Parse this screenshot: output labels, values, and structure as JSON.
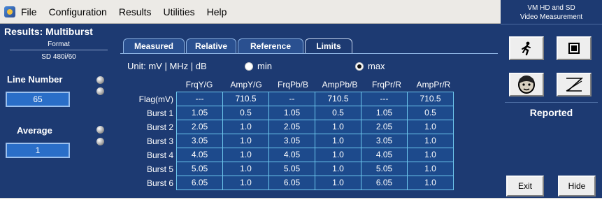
{
  "menubar": {
    "items": [
      "File",
      "Configuration",
      "Results",
      "Utilities",
      "Help"
    ]
  },
  "left_panel": {
    "title": "Results: Multiburst",
    "format_label": "Format",
    "format_value": "SD 480i/60",
    "line_number_label": "Line Number",
    "line_number_value": "65",
    "average_label": "Average",
    "average_value": "1"
  },
  "tabs": [
    "Measured",
    "Relative",
    "Reference",
    "Limits"
  ],
  "active_tab": "Limits",
  "unit_label": "Unit: mV | MHz | dB",
  "radio": {
    "min": "min",
    "max": "max",
    "selected": "max"
  },
  "table": {
    "columns": [
      "FrqY/G",
      "AmpY/G",
      "FrqPb/B",
      "AmpPb/B",
      "FrqPr/R",
      "AmpPr/R"
    ],
    "rows": [
      {
        "label": "Flag(mV)",
        "cells": [
          "---",
          "710.5",
          "--",
          "710.5",
          "---",
          "710.5"
        ]
      },
      {
        "label": "Burst 1",
        "cells": [
          "1.05",
          "0.5",
          "1.05",
          "0.5",
          "1.05",
          "0.5"
        ]
      },
      {
        "label": "Burst 2",
        "cells": [
          "2.05",
          "1.0",
          "2.05",
          "1.0",
          "2.05",
          "1.0"
        ]
      },
      {
        "label": "Burst 3",
        "cells": [
          "3.05",
          "1.0",
          "3.05",
          "1.0",
          "3.05",
          "1.0"
        ]
      },
      {
        "label": "Burst 4",
        "cells": [
          "4.05",
          "1.0",
          "4.05",
          "1.0",
          "4.05",
          "1.0"
        ]
      },
      {
        "label": "Burst 5",
        "cells": [
          "5.05",
          "1.0",
          "5.05",
          "1.0",
          "5.05",
          "1.0"
        ]
      },
      {
        "label": "Burst 6",
        "cells": [
          "6.05",
          "1.0",
          "6.05",
          "1.0",
          "6.05",
          "1.0"
        ]
      }
    ]
  },
  "right_panel": {
    "title_line1": "VM HD and SD",
    "title_line2": "Video Measurement",
    "reported_label": "Reported",
    "exit_label": "Exit",
    "hide_label": "Hide"
  },
  "colors": {
    "panel_bg": "#1d3a72",
    "cell_bg": "#1d4a8c",
    "grid_line": "#6ec8ee",
    "value_box": "#2a6ec8"
  }
}
